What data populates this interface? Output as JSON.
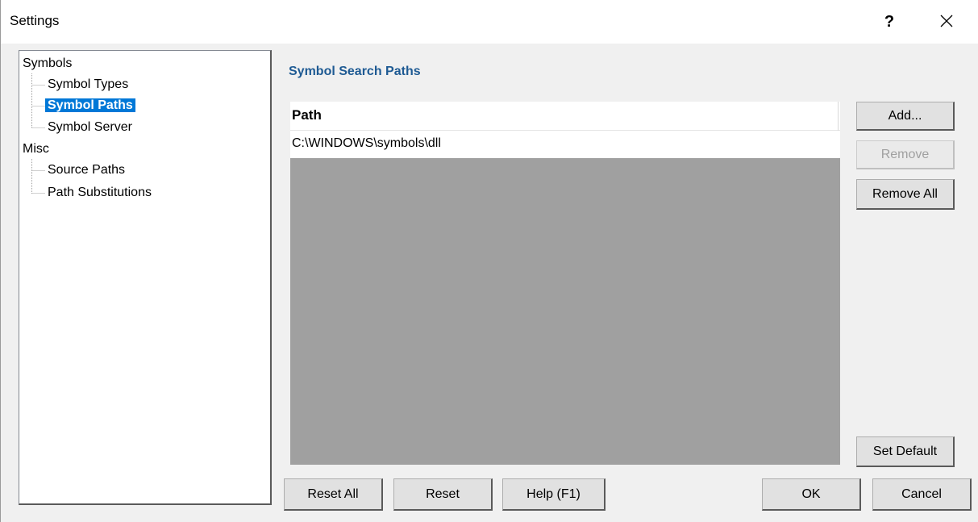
{
  "window": {
    "title": "Settings",
    "help_label": "?",
    "close_icon": "close-icon"
  },
  "tree": {
    "groups": [
      {
        "label": "Symbols",
        "children": [
          {
            "label": "Symbol Types",
            "selected": false
          },
          {
            "label": "Symbol Paths",
            "selected": true
          },
          {
            "label": "Symbol Server",
            "selected": false
          }
        ]
      },
      {
        "label": "Misc",
        "children": [
          {
            "label": "Source Paths",
            "selected": false
          },
          {
            "label": "Path Substitutions",
            "selected": false
          }
        ]
      }
    ]
  },
  "panel": {
    "heading": "Symbol Search Paths",
    "list": {
      "column_header": "Path",
      "rows": [
        "C:\\WINDOWS\\symbols\\dll"
      ]
    },
    "buttons": {
      "add": "Add...",
      "remove": "Remove",
      "remove_all": "Remove All",
      "set_default": "Set Default"
    }
  },
  "footer": {
    "reset_all": "Reset All",
    "reset": "Reset",
    "help": "Help (F1)",
    "ok": "OK",
    "cancel": "Cancel"
  },
  "colors": {
    "accent": "#0078d7",
    "heading": "#1e5a93",
    "list_background": "#a0a0a0"
  }
}
